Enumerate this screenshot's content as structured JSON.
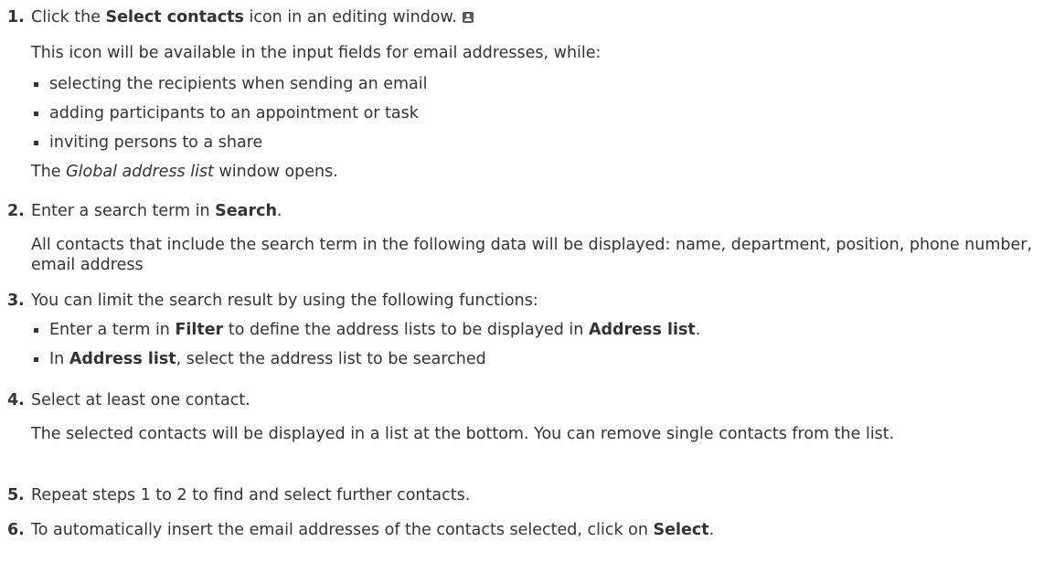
{
  "steps": [
    {
      "num": "1.",
      "pre": "Click the ",
      "bold": "Select contacts",
      "post": " icon in an editing window.",
      "icon": "contacts-card-icon",
      "note": "This icon will be available in the input fields for email addresses, while:",
      "bullets": [
        "selecting the recipients when sending an email",
        "adding participants to an appointment or task",
        "inviting persons to a share"
      ],
      "result_pre": "The ",
      "result_italic": "Global address list",
      "result_post": " window opens."
    },
    {
      "num": "2.",
      "pre": "Enter a search term in ",
      "bold": "Search",
      "post": ".",
      "note": "All contacts that include the search term in the following data will be displayed: name, department, position, phone number, email address"
    },
    {
      "num": "3.",
      "text": "You can limit the search result by using the following functions:",
      "bullets": [
        {
          "pre": "Enter a term in ",
          "bold1": "Filter",
          "mid": " to define the address lists to be displayed in ",
          "bold2": "Address list",
          "post": "."
        },
        {
          "pre": "In ",
          "bold1": "Address list",
          "post": ", select the address list to be searched"
        }
      ]
    },
    {
      "num": "4.",
      "text": "Select at least one contact.",
      "note": "The selected contacts will be displayed in a list at the bottom. You can remove single contacts from the list."
    },
    {
      "num": "5.",
      "text": "Repeat steps 1 to 2 to find and select further contacts."
    },
    {
      "num": "6.",
      "pre": "To automatically insert the email addresses of the contacts selected, click on ",
      "bold": "Select",
      "post": "."
    }
  ]
}
